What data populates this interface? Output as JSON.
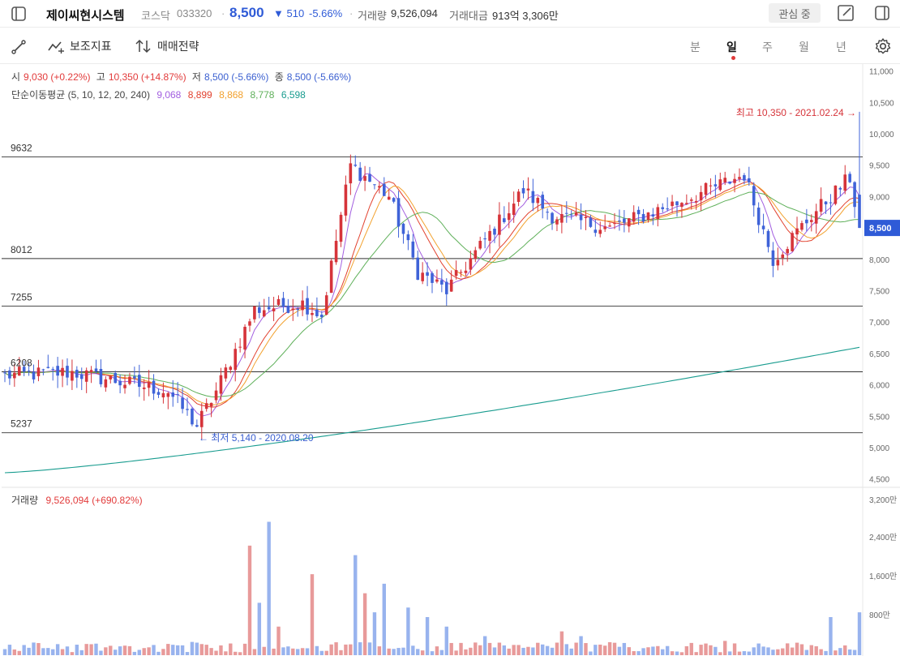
{
  "header": {
    "title": "제이씨현시스템",
    "market": "코스닥",
    "code": "033320",
    "sep": "·",
    "price": "8,500",
    "change": "▼ 510",
    "change_pct": "-5.66%",
    "volume_label": "거래량",
    "volume_value": "9,526,094",
    "amount_label": "거래대금",
    "amount_value": "913억 3,306만",
    "watch_label": "관심 중"
  },
  "toolbar": {
    "indicator_label": "보조지표",
    "strategy_label": "매매전략",
    "tabs": [
      "분",
      "일",
      "주",
      "월",
      "년"
    ],
    "active_tab": "일"
  },
  "ohlc": {
    "open_label": "시",
    "open_value": "9,030 (+0.22%)",
    "high_label": "고",
    "high_value": "10,350 (+14.87%)",
    "low_label": "저",
    "low_value": "8,500 (-5.66%)",
    "close_label": "종",
    "close_value": "8,500 (-5.66%)"
  },
  "ma": {
    "label": "단순이동평균 (5, 10, 12, 20, 240)",
    "values": [
      "9,068",
      "8,899",
      "8,868",
      "8,778",
      "6,598"
    ],
    "colors": [
      "#a25ee0",
      "#e2422f",
      "#f2a12e",
      "#5fb05a",
      "#199c8f"
    ]
  },
  "volume_legend": {
    "label": "거래량",
    "value": "9,526,094 (+690.82%)"
  },
  "colors": {
    "up": "#d6343a",
    "down": "#3f63d8",
    "up_vol": "#e89a9a",
    "down_vol": "#98b3ee",
    "accent": "#2f5bd7"
  },
  "chart_data": {
    "type": "candlestick",
    "price_axis": {
      "min": 4500,
      "max": 11000,
      "ticks": [
        "11,000",
        "10,500",
        "10,000",
        "9,500",
        "9,000",
        "8,500",
        "8,000",
        "7,500",
        "7,000",
        "6,500",
        "6,000",
        "5,500",
        "5,000",
        "4,500"
      ],
      "current_label": "8,500"
    },
    "volume_axis": {
      "ticks": [
        "3,200만",
        "2,400만",
        "1,600만",
        "800만"
      ]
    },
    "levels": [
      "9632",
      "8012",
      "7255",
      "6208",
      "5237"
    ],
    "max_annotation": "최고 10,350 - 2021.02.24 →",
    "min_annotation": "← 최저 5,140 - 2020.08.20"
  }
}
